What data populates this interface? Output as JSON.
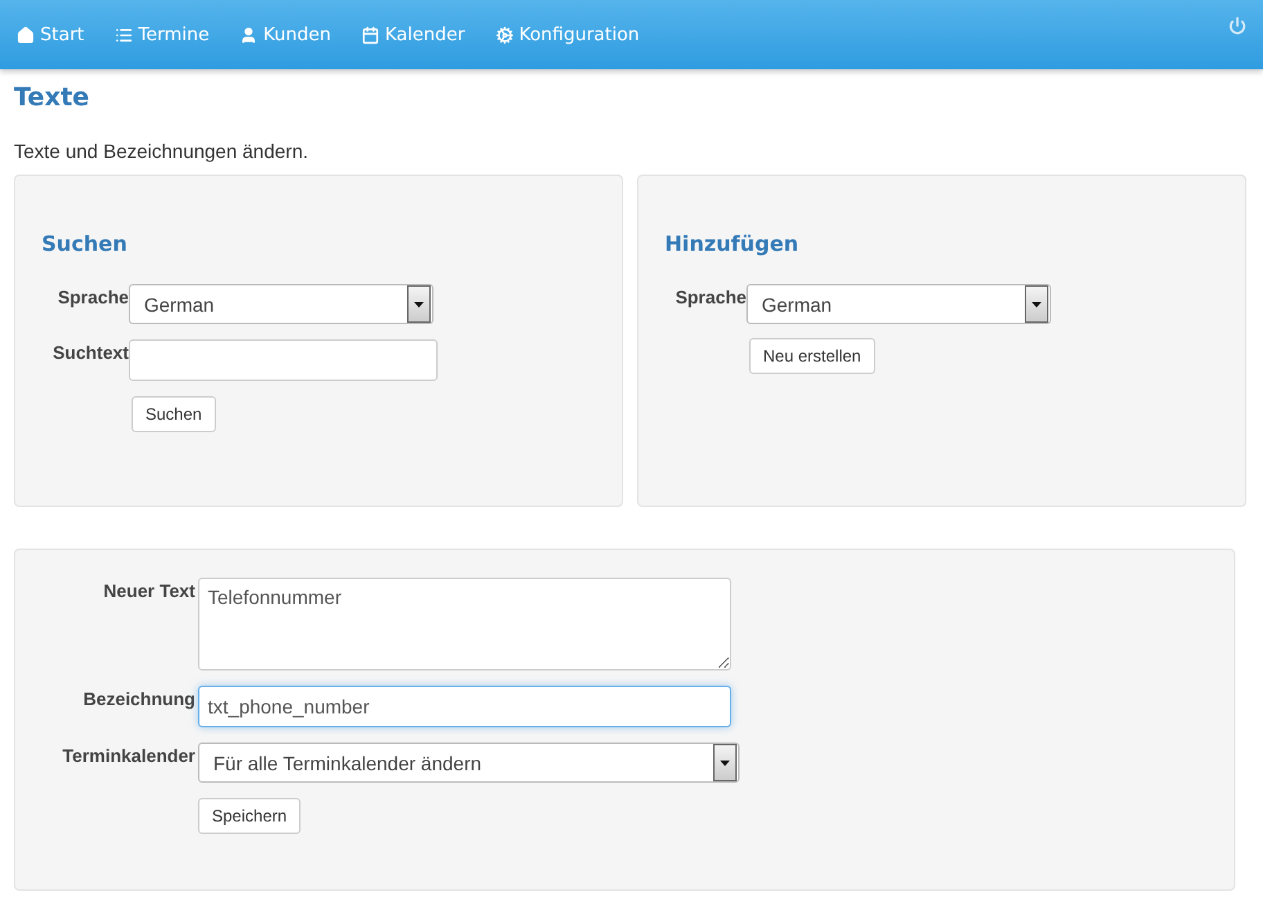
{
  "navbar": {
    "items": [
      {
        "label": "Start"
      },
      {
        "label": "Termine"
      },
      {
        "label": "Kunden"
      },
      {
        "label": "Kalender"
      },
      {
        "label": "Konfiguration"
      }
    ]
  },
  "page": {
    "title": "Texte",
    "description": "Texte und Bezeichnungen ändern."
  },
  "search_panel": {
    "title": "Suchen",
    "language_label": "Sprache",
    "language_value": "German",
    "search_label": "Suchtext",
    "button": "Suchen"
  },
  "add_panel": {
    "title": "Hinzufügen",
    "language_label": "Sprache",
    "language_value": "German",
    "button": "Neu erstellen"
  },
  "edit_panel": {
    "fields": [
      {
        "kind": "textarea",
        "label": "Neuer Text",
        "value": "Telefonnummer",
        "focused": false
      },
      {
        "kind": "input",
        "label": "Bezeichnung",
        "value": "txt_phone_number",
        "focused": true
      },
      {
        "kind": "select",
        "label": "Terminkalender",
        "value": "Für alle Terminkalender ändern",
        "focused": false
      }
    ],
    "button": "Speichern"
  }
}
